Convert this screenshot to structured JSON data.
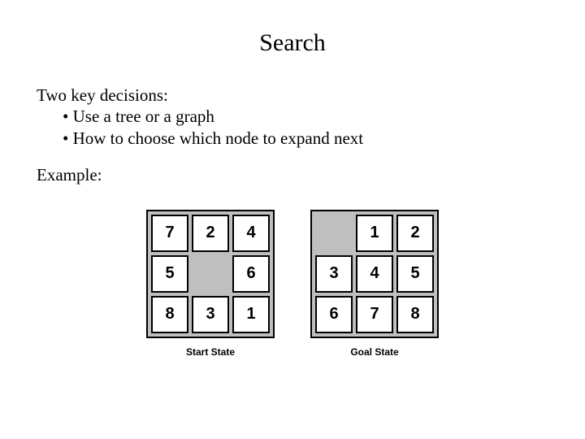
{
  "title": "Search",
  "intro": "Two key decisions:",
  "bullets": {
    "b1": "• Use a tree or a graph",
    "b2": "• How to choose which node to expand next"
  },
  "example_label": "Example:",
  "start": {
    "caption": "Start State",
    "cells": {
      "c0": "7",
      "c1": "2",
      "c2": "4",
      "c3": "5",
      "c4": "",
      "c5": "6",
      "c6": "8",
      "c7": "3",
      "c8": "1"
    }
  },
  "goal": {
    "caption": "Goal State",
    "cells": {
      "c0": "",
      "c1": "1",
      "c2": "2",
      "c3": "3",
      "c4": "4",
      "c5": "5",
      "c6": "6",
      "c7": "7",
      "c8": "8"
    }
  }
}
